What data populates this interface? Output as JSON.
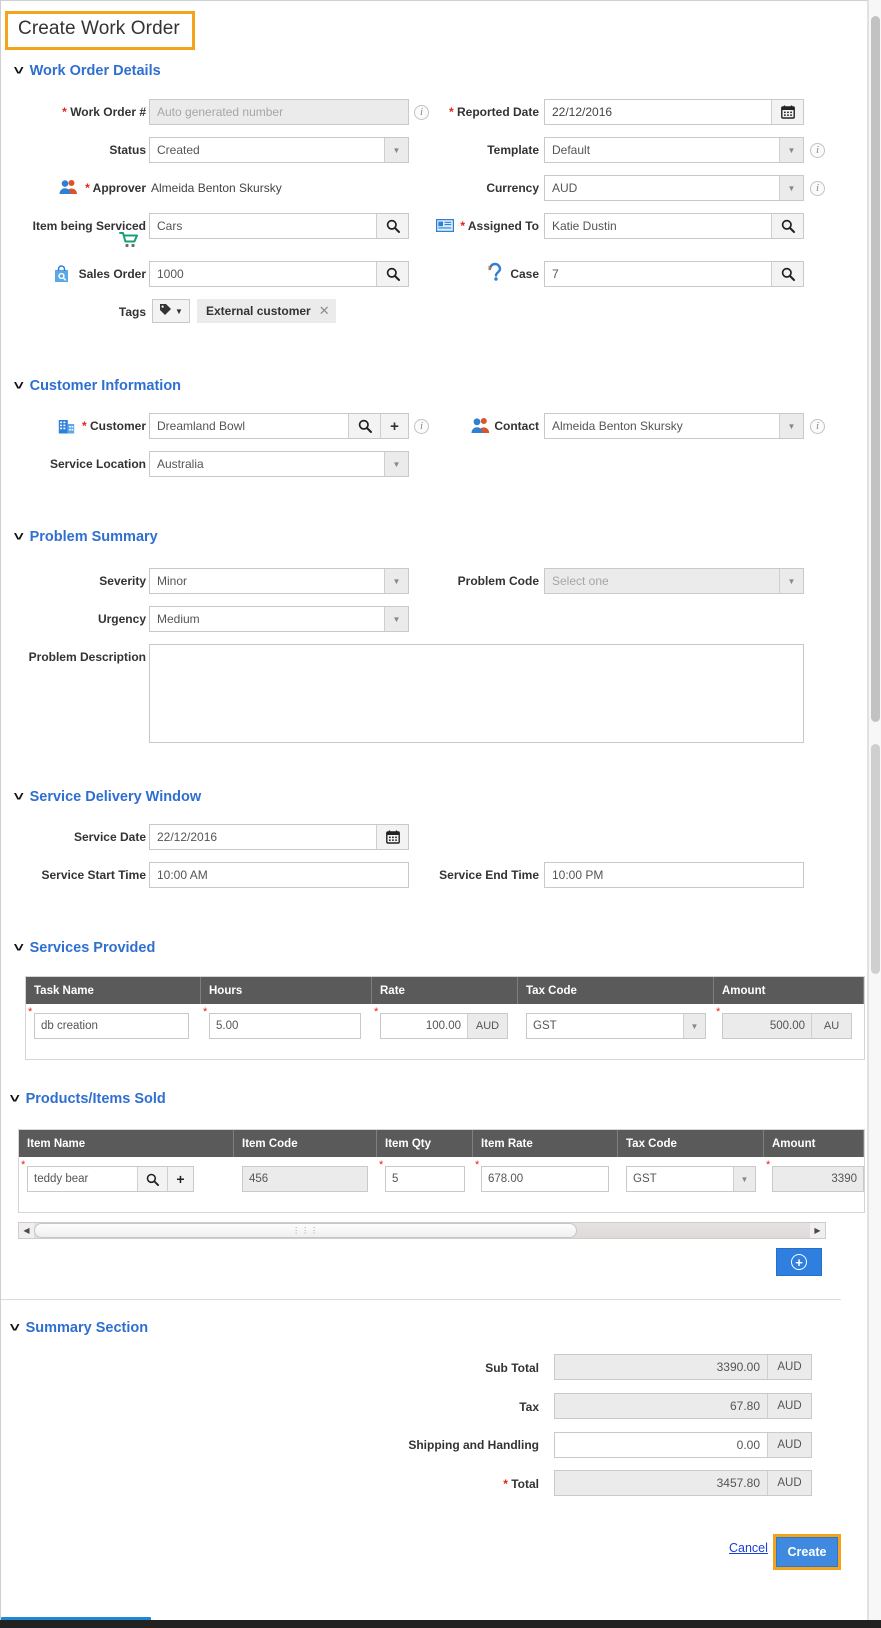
{
  "page_title": "Create Work Order",
  "sections": {
    "work_order_details": {
      "title": "Work Order Details",
      "fields": {
        "work_order_number": {
          "label": "Work Order #",
          "placeholder": "Auto generated number",
          "value": "",
          "required": true
        },
        "status": {
          "label": "Status",
          "value": "Created"
        },
        "approver": {
          "label": "Approver",
          "value": "Almeida Benton Skursky",
          "required": true
        },
        "item_being_serviced": {
          "label": "Item being Serviced",
          "value": "Cars"
        },
        "sales_order": {
          "label": "Sales Order",
          "value": "1000"
        },
        "tags": {
          "label": "Tags",
          "chip": "External customer"
        },
        "reported_date": {
          "label": "Reported Date",
          "value": "22/12/2016",
          "required": true
        },
        "template": {
          "label": "Template",
          "value": "Default"
        },
        "currency": {
          "label": "Currency",
          "value": "AUD"
        },
        "assigned_to": {
          "label": "Assigned To",
          "value": "Katie Dustin",
          "required": true
        },
        "case": {
          "label": "Case",
          "value": "7"
        }
      }
    },
    "customer_information": {
      "title": "Customer Information",
      "fields": {
        "customer": {
          "label": "Customer",
          "value": "Dreamland Bowl",
          "required": true
        },
        "service_location": {
          "label": "Service Location",
          "value": "Australia"
        },
        "contact": {
          "label": "Contact",
          "value": "Almeida Benton Skursky"
        }
      }
    },
    "problem_summary": {
      "title": "Problem Summary",
      "fields": {
        "severity": {
          "label": "Severity",
          "value": "Minor"
        },
        "urgency": {
          "label": "Urgency",
          "value": "Medium"
        },
        "problem_code": {
          "label": "Problem Code",
          "placeholder": "Select one",
          "value": ""
        },
        "problem_description": {
          "label": "Problem Description",
          "value": ""
        }
      }
    },
    "service_delivery_window": {
      "title": "Service Delivery Window",
      "fields": {
        "service_date": {
          "label": "Service Date",
          "value": "22/12/2016"
        },
        "service_start_time": {
          "label": "Service Start Time",
          "value": "10:00 AM"
        },
        "service_end_time": {
          "label": "Service End Time",
          "value": "10:00 PM"
        }
      }
    },
    "services_provided": {
      "title": "Services Provided",
      "columns": [
        "Task Name",
        "Hours",
        "Rate",
        "Tax Code",
        "Amount"
      ],
      "rows": [
        {
          "task_name": "db creation",
          "hours": "5.00",
          "rate": "100.00",
          "rate_currency": "AUD",
          "tax_code": "GST",
          "amount": "500.00",
          "amount_currency": "AU"
        }
      ]
    },
    "products_items_sold": {
      "title": "Products/Items Sold",
      "columns": [
        "Item Name",
        "Item Code",
        "Item Qty",
        "Item Rate",
        "Tax Code",
        "Amount"
      ],
      "rows": [
        {
          "item_name": "teddy bear",
          "item_code": "456",
          "item_qty": "5",
          "item_rate": "678.00",
          "tax_code": "GST",
          "amount": "3390"
        }
      ],
      "add_row_label": "+"
    },
    "summary_section": {
      "title": "Summary Section",
      "rows": [
        {
          "label": "Sub Total",
          "value": "3390.00",
          "currency": "AUD",
          "readonly": true,
          "required": false
        },
        {
          "label": "Tax",
          "value": "67.80",
          "currency": "AUD",
          "readonly": true,
          "required": false
        },
        {
          "label": "Shipping and Handling",
          "value": "0.00",
          "currency": "AUD",
          "readonly": false,
          "required": false
        },
        {
          "label": "Total",
          "value": "3457.80",
          "currency": "AUD",
          "readonly": true,
          "required": true
        }
      ]
    }
  },
  "footer": {
    "cancel_label": "Cancel",
    "create_label": "Create"
  },
  "colors": {
    "section_heading": "#2f6fd0",
    "highlight_border": "#f5a31a",
    "primary_button": "#3f8ae0",
    "required_star": "#e2231a",
    "table_header": "#5a5a5a"
  }
}
